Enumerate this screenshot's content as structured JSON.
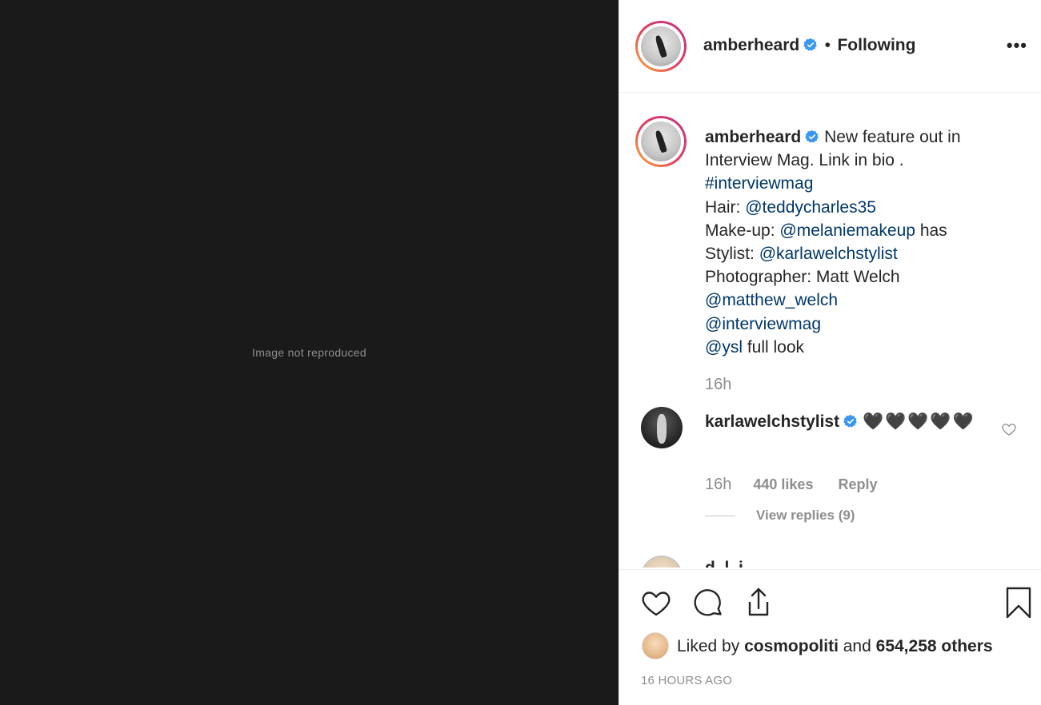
{
  "photo": {
    "note": "Image not reproduced"
  },
  "header": {
    "username": "amberheard",
    "separator": "•",
    "follow_state": "Following",
    "more": "•••"
  },
  "caption": {
    "username": "amberheard",
    "line1": "New feature out in Interview Mag. Link in bio .",
    "hashtag": "#interviewmag",
    "hair_label": "Hair:",
    "hair_handle": "@teddycharles35",
    "makeup_label": "Make-up:",
    "makeup_handle": "@melaniemakeup",
    "makeup_suffix": "has",
    "stylist_label": "Stylist:",
    "stylist_handle": "@karlawelchstylist",
    "photographer": "Photographer: Matt Welch",
    "photographer_handle": "@matthew_welch",
    "mag_handle": "@interviewmag",
    "ysl_handle": "@ysl",
    "ysl_suffix": "full look",
    "time": "16h"
  },
  "comment": {
    "username": "karlawelchstylist",
    "text": "🖤🖤🖤🖤🖤",
    "time": "16h",
    "likes": "440 likes",
    "reply": "Reply",
    "view_replies": "View replies (9)"
  },
  "next_comment": {
    "username_partial": "d..l..i"
  },
  "footer": {
    "liked_prefix": "Liked by",
    "liked_user": "cosmopoliti",
    "liked_and": "and",
    "liked_others": "654,258 others",
    "post_time": "16 HOURS AGO"
  },
  "colors": {
    "link": "#00376b",
    "muted": "#8e8e8e",
    "verified": "#3897f0",
    "ring_start": "#f9b43a",
    "ring_end": "#c13584"
  }
}
